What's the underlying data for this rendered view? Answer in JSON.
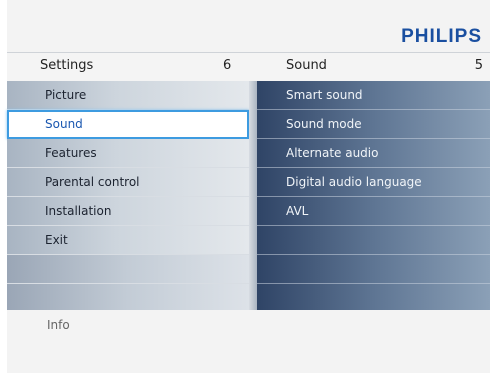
{
  "brand": "PHILIPS",
  "header": {
    "left_title": "Settings",
    "left_count": "6",
    "right_title": "Sound",
    "right_count": "5"
  },
  "left_menu": {
    "items": [
      {
        "label": "Picture"
      },
      {
        "label": "Sound",
        "selected": true
      },
      {
        "label": "Features"
      },
      {
        "label": "Parental control"
      },
      {
        "label": "Installation"
      },
      {
        "label": "Exit"
      },
      {
        "label": ""
      },
      {
        "label": ""
      }
    ]
  },
  "right_menu": {
    "items": [
      {
        "label": "Smart sound"
      },
      {
        "label": "Sound mode"
      },
      {
        "label": "Alternate audio"
      },
      {
        "label": "Digital audio language"
      },
      {
        "label": "AVL"
      },
      {
        "label": ""
      },
      {
        "label": ""
      },
      {
        "label": ""
      }
    ]
  },
  "footer": {
    "info_label": "Info"
  },
  "colors": {
    "brand": "#1a4fa0",
    "selection_border": "#3d9be0",
    "selected_text": "#1a57b0"
  }
}
